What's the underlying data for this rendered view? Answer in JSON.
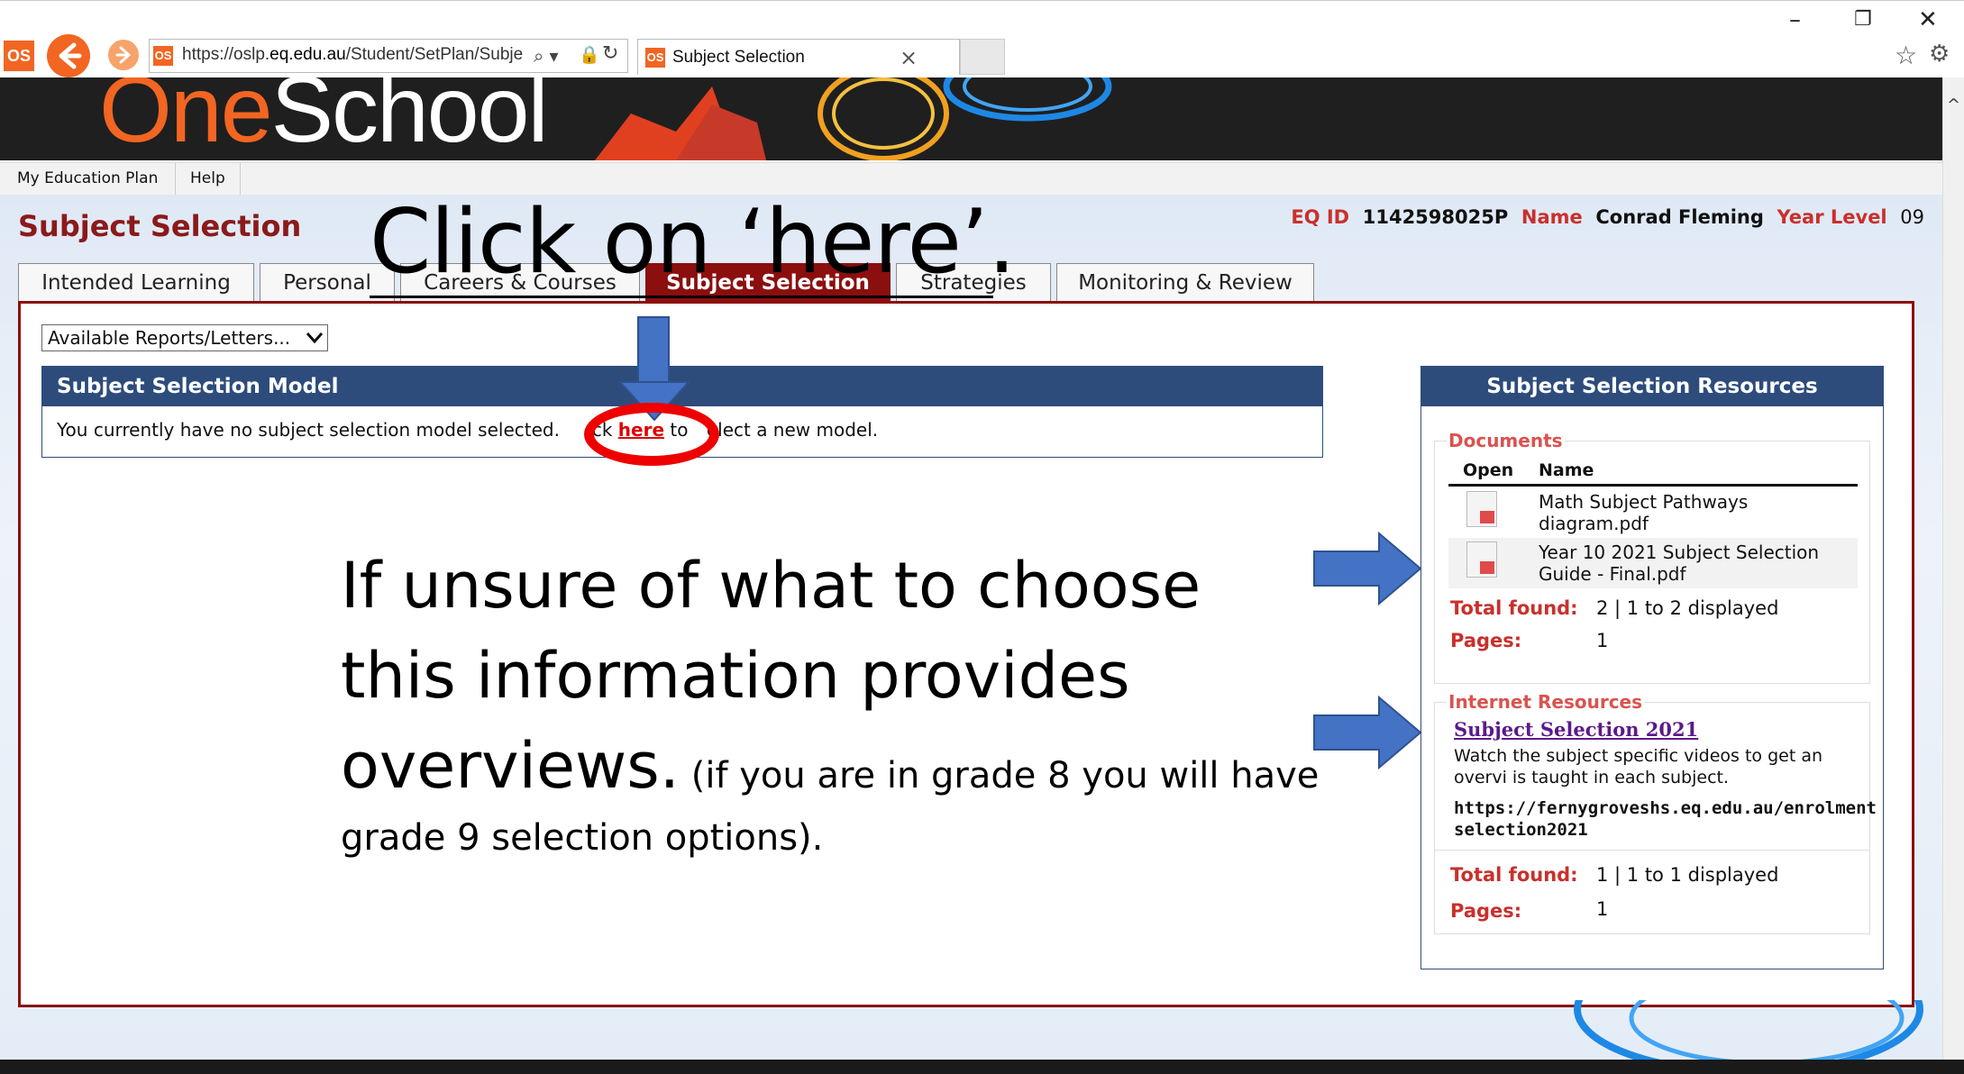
{
  "browser": {
    "url_prefix": "https://oslp.",
    "url_domain": "eq.edu.au",
    "url_path": "/Student/SetPlan/Subje",
    "tab_title": "Subject Selection",
    "tab_close": "×",
    "app_icon": "OS",
    "min": "–",
    "restore": "❐",
    "close": "✕"
  },
  "banner": {
    "logo_one": "One",
    "logo_school": "School"
  },
  "menu": {
    "items": [
      "My Education Plan",
      "Help"
    ]
  },
  "page": {
    "title": "Subject Selection",
    "eq_id_label": "EQ ID",
    "eq_id": "1142598025P",
    "name_label": "Name",
    "name": "Conrad Fleming",
    "year_label": "Year Level",
    "year": "09"
  },
  "tabs": [
    "Intended Learning",
    "Personal",
    "Careers & Courses",
    "Subject Selection",
    "Strategies",
    "Monitoring & Review"
  ],
  "reports_select": "Available Reports/Letters...",
  "model": {
    "header": "Subject Selection Model",
    "text_before": "You currently have no subject selection model selected.   ",
    "text_click": "ick ",
    "link": "here",
    "text_after": " to ",
    "text_end": "elect a new model."
  },
  "resources": {
    "header": "Subject Selection Resources",
    "documents_legend": "Documents",
    "col_open": "Open",
    "col_name": "Name",
    "documents": [
      "Math Subject Pathways diagram.pdf",
      "Year 10 2021 Subject Selection Guide - Final.pdf"
    ],
    "total_label": "Total found:",
    "docs_total": "2 | 1 to 2 displayed",
    "pages_label": "Pages:",
    "docs_pages": "1",
    "internet_legend": "Internet Resources",
    "internet_link": "Subject Selection 2021",
    "internet_desc": "Watch the subject specific videos to get an overvi is taught in each subject.",
    "internet_url": "https://fernygroveshs.eq.edu.au/enrolment selection2021",
    "internet_total": "1 | 1 to 1 displayed",
    "internet_pages": "1"
  },
  "annotations": {
    "click_here": "Click on ‘here’.",
    "big_line1": "If unsure of what to choose",
    "big_line2": "this information provides",
    "big_line3": "overviews.",
    "small_tail": " (if you are in grade 8 you will have",
    "small_line2": "grade 9 selection options)."
  }
}
